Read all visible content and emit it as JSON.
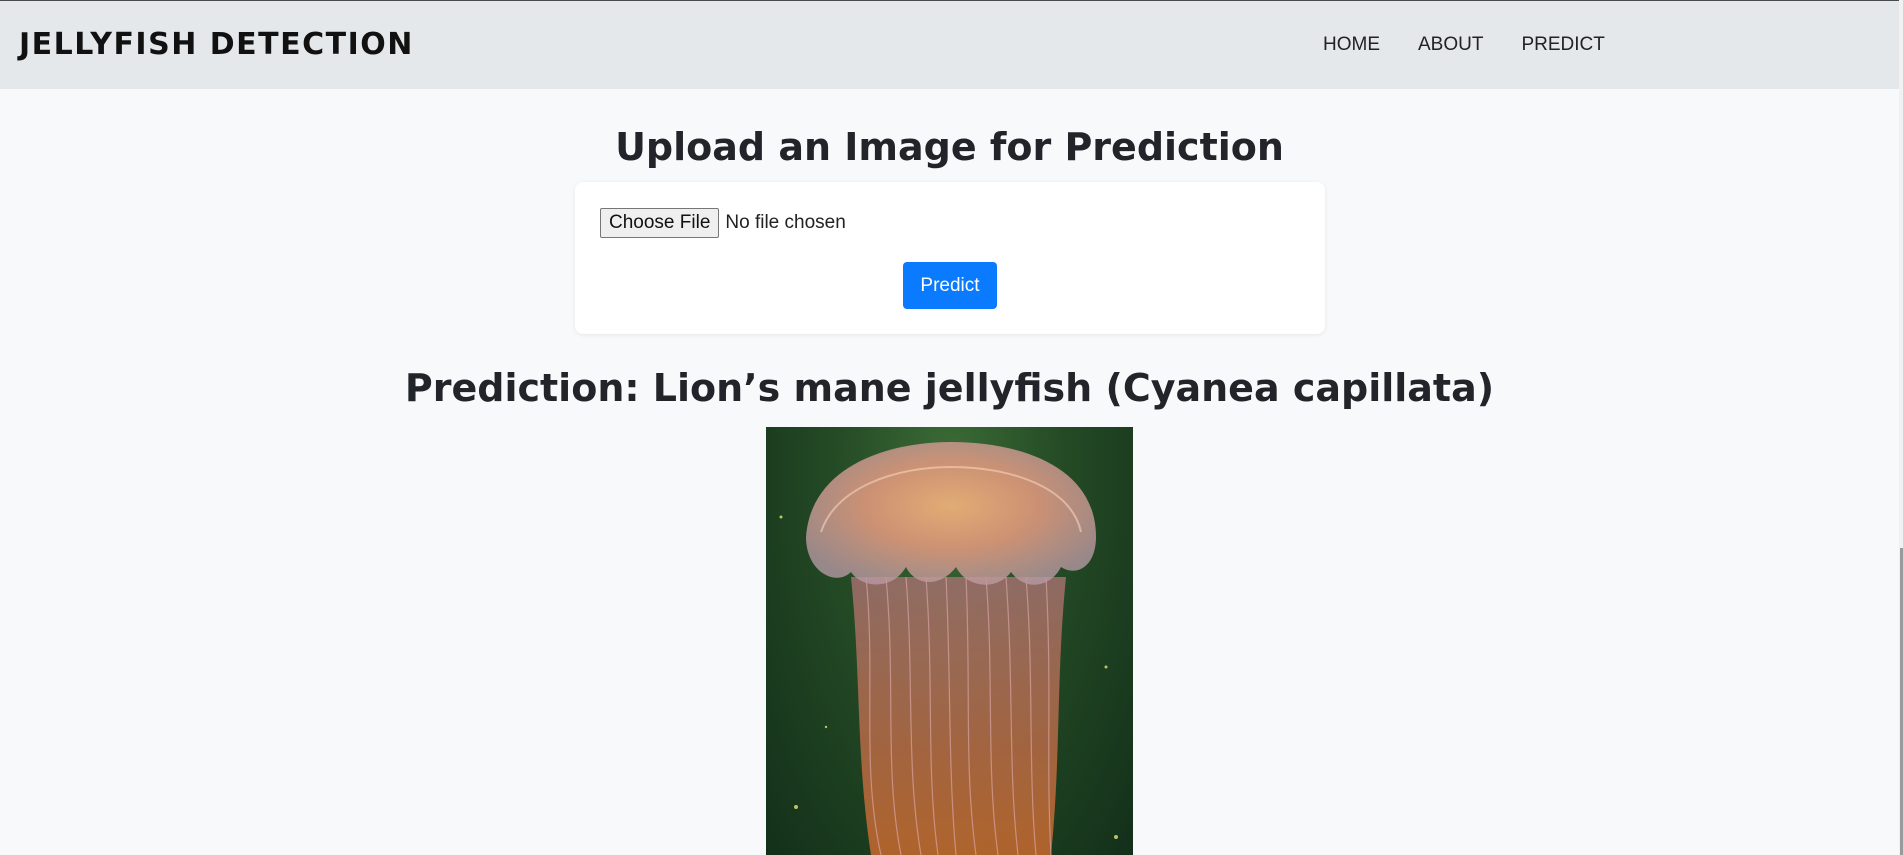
{
  "navbar": {
    "brand": "JELLYFISH DETECTION",
    "links": [
      "HOME",
      "ABOUT",
      "PREDICT"
    ]
  },
  "upload": {
    "title": "Upload an Image for Prediction",
    "choose_file_label": "Choose File",
    "file_status": "No file chosen",
    "predict_label": "Predict"
  },
  "result": {
    "prediction_text": "Prediction: Lion’s mane jellyfish (Cyanea capillata)",
    "image_subject": "jellyfish-photo"
  },
  "colors": {
    "navbar_bg": "#e5e8eb",
    "page_bg": "#f8f9fa",
    "primary": "#0a7bff"
  }
}
